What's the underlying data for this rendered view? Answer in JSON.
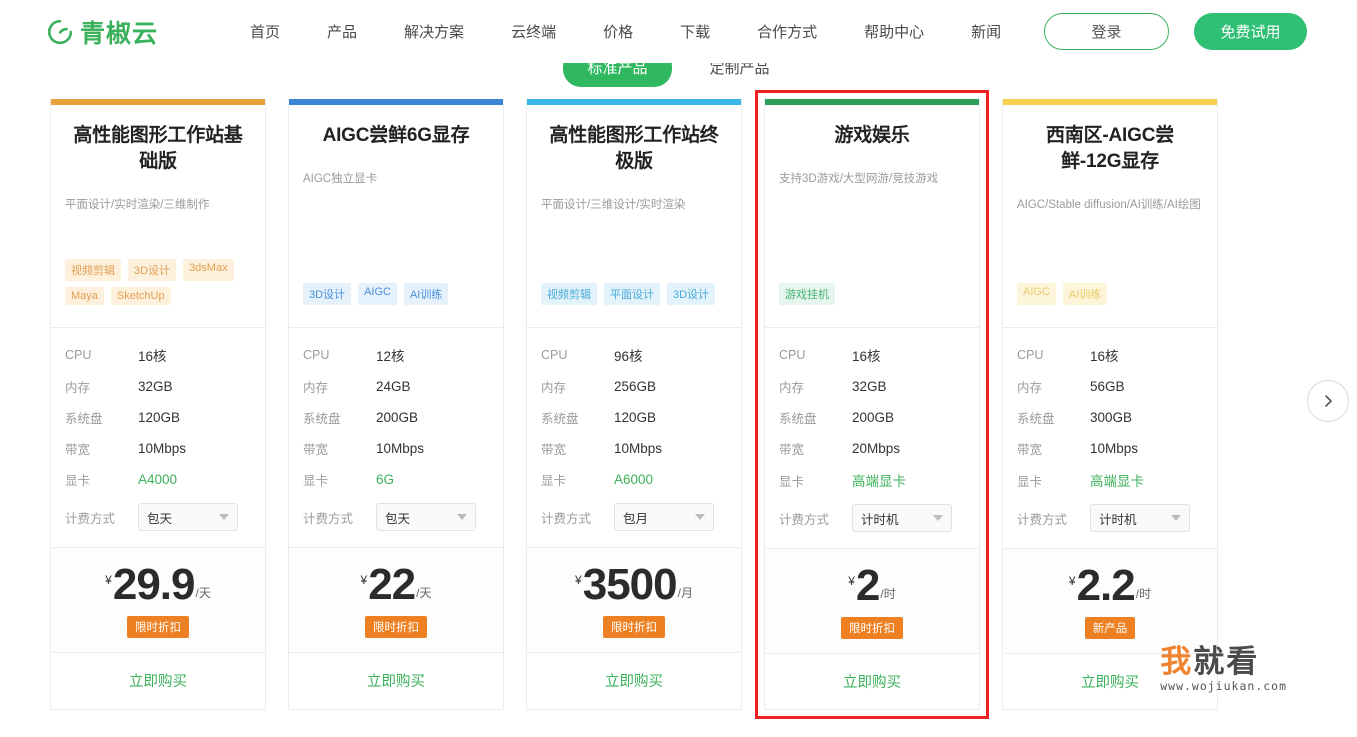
{
  "brand": {
    "logo_text": "青椒云",
    "logo_color": "#3cb15b"
  },
  "nav": {
    "items": [
      {
        "label": "首页"
      },
      {
        "label": "产品"
      },
      {
        "label": "解决方案"
      },
      {
        "label": "云终端"
      },
      {
        "label": "价格"
      },
      {
        "label": "下载"
      },
      {
        "label": "合作方式"
      },
      {
        "label": "帮助中心"
      },
      {
        "label": "新闻"
      }
    ],
    "login_label": "登录",
    "trial_label": "免费试用"
  },
  "tabs": [
    {
      "label": "标准产品",
      "active": true
    },
    {
      "label": "定制产品",
      "active": false
    }
  ],
  "spec_labels": {
    "cpu": "CPU",
    "memory": "内存",
    "disk": "系统盘",
    "bandwidth": "带宽",
    "gpu": "显卡",
    "billing": "计费方式"
  },
  "buy_label": "立即购买",
  "carousel": {
    "next_icon": "chevron-right-icon"
  },
  "watermark": {
    "text_orange": "我",
    "text_dark": "就看",
    "url": "www.wojiukan.com"
  },
  "cards": [
    {
      "stripe_color": "#e9a13b",
      "title": "高性能图形工作站基础版",
      "subtitle": "平面设计/实时渲染/三维制作",
      "tag_bg": "#fdf0dd",
      "tag_color": "#e0a051",
      "tags": [
        "视频剪辑",
        "3D设计",
        "3dsMax",
        "Maya",
        "SketchUp"
      ],
      "cpu": "16核",
      "memory": "32GB",
      "disk": "120GB",
      "bandwidth": "10Mbps",
      "gpu": "A4000",
      "billing": "包天",
      "currency": "¥",
      "price": "29.9",
      "unit": "/天",
      "badge": "限时折扣",
      "highlighted": false
    },
    {
      "stripe_color": "#3b82d9",
      "title": "AIGC尝鲜6G显存",
      "subtitle": "AIGC独立显卡",
      "tag_bg": "#e5f1fb",
      "tag_color": "#4a90d9",
      "tags": [
        "3D设计",
        "AIGC",
        "AI训练"
      ],
      "cpu": "12核",
      "memory": "24GB",
      "disk": "200GB",
      "bandwidth": "10Mbps",
      "gpu": "6G",
      "billing": "包天",
      "currency": "¥",
      "price": "22",
      "unit": "/天",
      "badge": "限时折扣",
      "highlighted": false
    },
    {
      "stripe_color": "#3bb7e8",
      "title": "高性能图形工作站终极版",
      "subtitle": "平面设计/三维设计/实时渲染",
      "tag_bg": "#e3f3fb",
      "tag_color": "#47a9d6",
      "tags": [
        "视频剪辑",
        "平面设计",
        "3D设计"
      ],
      "cpu": "96核",
      "memory": "256GB",
      "disk": "120GB",
      "bandwidth": "10Mbps",
      "gpu": "A6000",
      "billing": "包月",
      "currency": "¥",
      "price": "3500",
      "unit": "/月",
      "badge": "限时折扣",
      "highlighted": false
    },
    {
      "stripe_color": "#2ca05a",
      "title": "游戏娱乐",
      "subtitle": "支持3D游戏/大型网游/竞技游戏",
      "tag_bg": "#e6f6ec",
      "tag_color": "#46b173",
      "tags": [
        "游戏挂机"
      ],
      "cpu": "16核",
      "memory": "32GB",
      "disk": "200GB",
      "bandwidth": "20Mbps",
      "gpu": "高端显卡",
      "billing": "计时机",
      "currency": "¥",
      "price": "2",
      "unit": "/时",
      "badge": "限时折扣",
      "highlighted": true
    },
    {
      "stripe_color": "#f5cf4d",
      "title": "西南区-AIGC尝鲜-12G显存",
      "subtitle": "AIGC/Stable diffusion/AI训练/AI绘图",
      "tag_bg": "#fdf5da",
      "tag_color": "#e8cb6a",
      "tags": [
        "AIGC",
        "AI训练"
      ],
      "cpu": "16核",
      "memory": "56GB",
      "disk": "300GB",
      "bandwidth": "10Mbps",
      "gpu": "高端显卡",
      "billing": "计时机",
      "currency": "¥",
      "price": "2.2",
      "unit": "/时",
      "badge": "新产品",
      "highlighted": false
    }
  ]
}
